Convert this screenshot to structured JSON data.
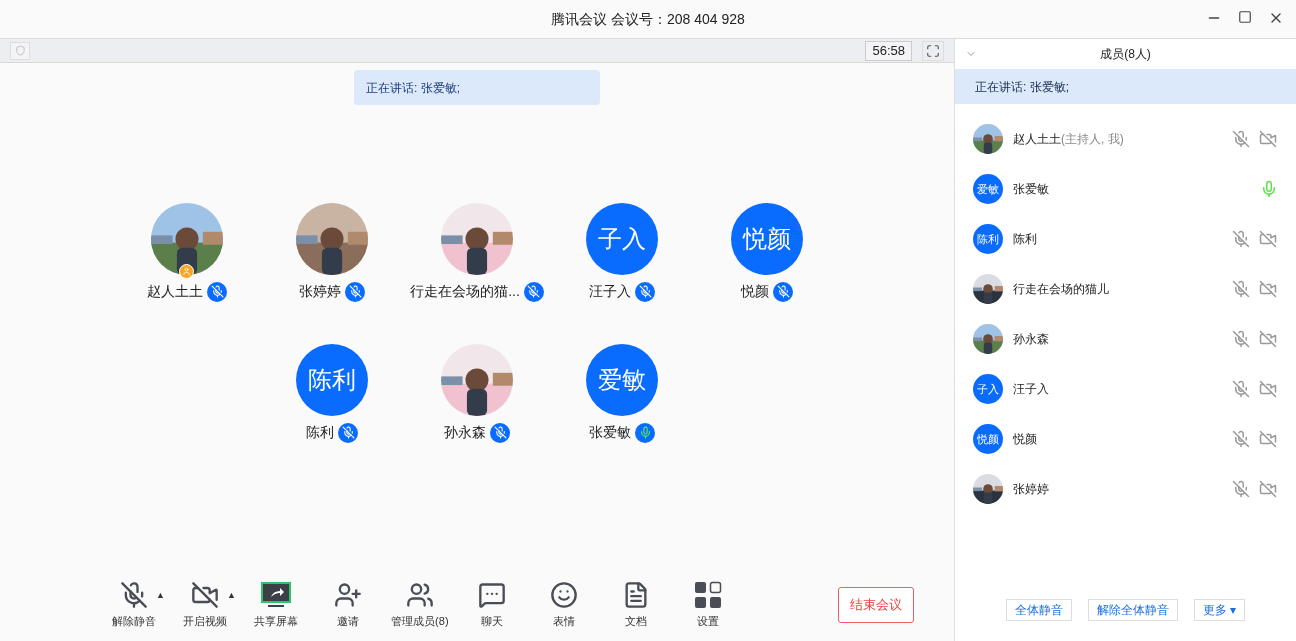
{
  "window": {
    "title": "腾讯会议 会议号：208 404 928"
  },
  "meeting": {
    "timer": "56:58",
    "speaking_banner": "正在讲话: 张爱敏;",
    "participants": [
      {
        "name": "赵人土土",
        "muted": true,
        "host": true
      },
      {
        "name": "张婷婷",
        "muted": true,
        "host": false
      },
      {
        "name": "行走在会场的猫...",
        "muted": true,
        "host": false
      },
      {
        "name": "汪子入",
        "avatar": {
          "kind": "initials",
          "text": "子入"
        },
        "muted": true,
        "host": false
      },
      {
        "name": "悦颜",
        "avatar": {
          "kind": "initials",
          "text": "悦颜"
        },
        "muted": true,
        "host": false
      },
      {
        "name": "陈利",
        "avatar": {
          "kind": "initials",
          "text": "陈利"
        },
        "muted": true,
        "host": false
      },
      {
        "name": "孙永森",
        "muted": true,
        "host": false
      },
      {
        "name": "张爱敏",
        "avatar": {
          "kind": "initials",
          "text": "爱敏"
        },
        "muted": false,
        "host": false
      }
    ]
  },
  "toolbar": [
    {
      "kind": "mic",
      "label": "解除静音",
      "caret": "▲"
    },
    {
      "kind": "video",
      "label": "开启视频",
      "caret": "▲"
    },
    {
      "kind": "share",
      "label": "共享屏幕"
    },
    {
      "kind": "invite",
      "label": "邀请"
    },
    {
      "kind": "members",
      "label": "管理成员(8)"
    },
    {
      "kind": "chat",
      "label": "聊天"
    },
    {
      "kind": "emoji",
      "label": "表情"
    },
    {
      "kind": "docs",
      "label": "文档"
    },
    {
      "kind": "settings",
      "label": "设置"
    }
  ],
  "end_button": "结束会议",
  "members_panel": {
    "title": "成员(8人)",
    "speaking_banner": "正在讲话: 张爱敏;",
    "members": [
      {
        "name": "赵人土土",
        "note": "(主持人, 我)",
        "muted": true,
        "camera_icon": true
      },
      {
        "name": "张爱敏",
        "avatar": {
          "kind": "initials",
          "text": "爱敏"
        },
        "muted": false,
        "camera_icon": false
      },
      {
        "name": "陈利",
        "avatar": {
          "kind": "initials",
          "text": "陈利"
        },
        "muted": true,
        "camera_icon": true
      },
      {
        "name": "行走在会场的猫儿",
        "muted": true,
        "camera_icon": true
      },
      {
        "name": "孙永森",
        "muted": true,
        "camera_icon": true
      },
      {
        "name": "汪子入",
        "avatar": {
          "kind": "initials",
          "text": "子入"
        },
        "muted": true,
        "camera_icon": true
      },
      {
        "name": "悦颜",
        "avatar": {
          "kind": "initials",
          "text": "悦颜"
        },
        "muted": true,
        "camera_icon": true
      },
      {
        "name": "张婷婷",
        "muted": true,
        "camera_icon": true
      }
    ],
    "buttons": [
      {
        "label": "全体静音"
      },
      {
        "label": "解除全体静音"
      },
      {
        "label": "更多",
        "caret": "▾"
      }
    ]
  }
}
